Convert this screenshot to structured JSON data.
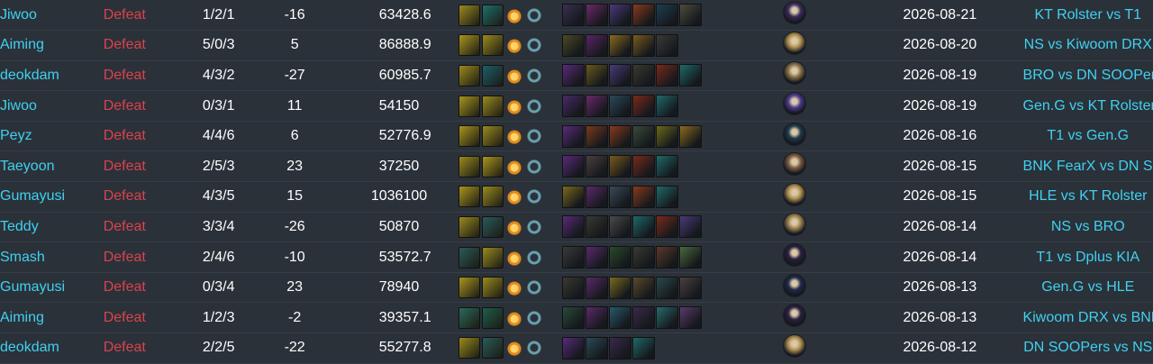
{
  "colors": {
    "background": "#2b3139",
    "player_link": "#3fd1f0",
    "defeat": "#d8434c",
    "value_text": "#ffffff"
  },
  "rows": [
    {
      "player": "Jiwoo",
      "result": "Defeat",
      "kda": "1/2/1",
      "diff": "-16",
      "dmg": "634",
      "kp": "28.6",
      "date": "2026-08-21",
      "match": "KT Rolster vs T1",
      "runes": [
        "#9a8a1f",
        "#1d6f6a"
      ],
      "items": [
        "#3a2f52",
        "#6a2a6a",
        "#4a3a7a",
        "#8a3a1c",
        "#1f3f52",
        "#4c4c3c"
      ],
      "champ": "#3a2c5a"
    },
    {
      "player": "Aiming",
      "result": "Defeat",
      "kda": "5/0/3",
      "diff": "5",
      "dmg": "868",
      "kp": "88.9",
      "date": "2026-08-20",
      "match": "NS vs Kiwoom DRX",
      "runes": [
        "#a9951e",
        "#9a8a1f"
      ],
      "items": [
        "#4b4a24",
        "#5a2466",
        "#8b6a1e",
        "#7a5c1c",
        "#3b3a38"
      ],
      "champ": "#b09050"
    },
    {
      "player": "deokdam",
      "result": "Defeat",
      "kda": "4/3/2",
      "diff": "-27",
      "dmg": "609",
      "kp": "85.7",
      "date": "2026-08-19",
      "match": "BRO vs DN SOOPers",
      "runes": [
        "#9a8a1f",
        "#1d5e6a"
      ],
      "items": [
        "#5a2a7a",
        "#6a5a1e",
        "#4a3a7a",
        "#3a3a30",
        "#7a2a1a",
        "#1f6a6a"
      ],
      "champ": "#8a7048"
    },
    {
      "player": "Jiwoo",
      "result": "Defeat",
      "kda": "0/3/1",
      "diff": "11",
      "dmg": "541",
      "kp": "50",
      "date": "2026-08-19",
      "match": "Gen.G vs KT Rolster",
      "runes": [
        "#a9951e",
        "#9a8a1f"
      ],
      "items": [
        "#4a2a6a",
        "#6a2a6a",
        "#2a4a5a",
        "#7a2a1a",
        "#1f6a6a"
      ],
      "champ": "#4a3a8a"
    },
    {
      "player": "Peyz",
      "result": "Defeat",
      "kda": "4/4/6",
      "diff": "6",
      "dmg": "527",
      "kp": "76.9",
      "date": "2026-08-16",
      "match": "T1 vs Gen.G",
      "runes": [
        "#a9951e",
        "#9a8a1f"
      ],
      "items": [
        "#5a2a7a",
        "#7a3a1a",
        "#8a3a1c",
        "#3a4a3a",
        "#6a6a1c",
        "#8a6a1e"
      ],
      "champ": "#1f3a4a"
    },
    {
      "player": "Taeyoon",
      "result": "Defeat",
      "kda": "2/5/3",
      "diff": "23",
      "dmg": "372",
      "kp": "50",
      "date": "2026-08-15",
      "match": "BNK FearX vs DN SOOPers",
      "runes": [
        "#9a8a1f",
        "#a9951e"
      ],
      "items": [
        "#5a2a7a",
        "#4a4040",
        "#7a5a1c",
        "#7a2a1a",
        "#1f6a6a"
      ],
      "champ": "#7a5a40"
    },
    {
      "player": "Gumayusi",
      "result": "Defeat",
      "kda": "4/3/5",
      "diff": "15",
      "dmg": "1036",
      "kp": "100",
      "date": "2026-08-15",
      "match": "HLE vs KT Rolster",
      "runes": [
        "#a9951e",
        "#9a8a1f"
      ],
      "items": [
        "#7a6a1e",
        "#5a2a6a",
        "#3a4a5a",
        "#8a3a1c",
        "#1f6a6a"
      ],
      "champ": "#b09050"
    },
    {
      "player": "Teddy",
      "result": "Defeat",
      "kda": "3/3/4",
      "diff": "-26",
      "dmg": "508",
      "kp": "70",
      "date": "2026-08-14",
      "match": "NS vs BRO",
      "runes": [
        "#9a8a1f",
        "#2a5a5a"
      ],
      "items": [
        "#5a2a7a",
        "#3a3a30",
        "#4a4a4a",
        "#1f6a6a",
        "#7a2a1a",
        "#4a3a7a"
      ],
      "champ": "#a08050"
    },
    {
      "player": "Smash",
      "result": "Defeat",
      "kda": "2/4/6",
      "diff": "-10",
      "dmg": "535",
      "kp": "72.7",
      "date": "2026-08-14",
      "match": "T1 vs Dplus KIA",
      "runes": [
        "#2a5a5a",
        "#9a8a1f"
      ],
      "items": [
        "#3a3a3a",
        "#5a2a6a",
        "#2a4a2a",
        "#3a3a30",
        "#5a3a2a",
        "#4a6a3a"
      ],
      "champ": "#2a2040"
    },
    {
      "player": "Gumayusi",
      "result": "Defeat",
      "kda": "0/3/4",
      "diff": "23",
      "dmg": "789",
      "kp": "40",
      "date": "2026-08-13",
      "match": "Gen.G vs HLE",
      "runes": [
        "#a9951e",
        "#9a8a1f"
      ],
      "items": [
        "#3a3a30",
        "#5a2a6a",
        "#7a6a1e",
        "#5a4a2a",
        "#2a4a4a",
        "#4a4040"
      ],
      "champ": "#1f2a4a"
    },
    {
      "player": "Aiming",
      "result": "Defeat",
      "kda": "1/2/3",
      "diff": "-2",
      "dmg": "393",
      "kp": "57.1",
      "date": "2026-08-13",
      "match": "Kiwoom DRX vs BNK FearX",
      "runes": [
        "#2a6a5a",
        "#1d5e4a"
      ],
      "items": [
        "#2a4a3a",
        "#5a2a6a",
        "#2a5a6a",
        "#3a2a4a",
        "#2a6a6a",
        "#5a3a6a"
      ],
      "champ": "#2a2040"
    },
    {
      "player": "deokdam",
      "result": "Defeat",
      "kda": "2/2/5",
      "diff": "-22",
      "dmg": "552",
      "kp": "77.8",
      "date": "2026-08-12",
      "match": "DN SOOPers vs NS",
      "runes": [
        "#9a8a1f",
        "#2a5a5a"
      ],
      "items": [
        "#5a2a7a",
        "#2a4a5a",
        "#3a2a4a",
        "#1f6a6a"
      ],
      "champ": "#b09050"
    }
  ]
}
